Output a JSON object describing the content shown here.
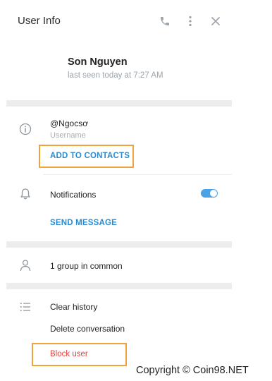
{
  "header": {
    "title": "User Info"
  },
  "profile": {
    "name": "Son Nguyen",
    "last_seen": "last seen today at 7:27 AM"
  },
  "info": {
    "username_value": "@Ngocsơ",
    "username_label": "Username",
    "add_contacts": "ADD TO CONTACTS"
  },
  "notifications": {
    "label": "Notifications",
    "enabled": true,
    "send_message": "SEND MESSAGE"
  },
  "groups": {
    "common": "1 group in common"
  },
  "actions": {
    "clear_history": "Clear history",
    "delete_conversation": "Delete conversation",
    "block_user": "Block user"
  },
  "watermark": {
    "text": "Copyright © Coin98.NET"
  },
  "colors": {
    "link": "#2a8bd0",
    "danger": "#e0403c",
    "highlight": "#f0a33c",
    "toggle_on": "#4aa3e6"
  },
  "icons": [
    "phone-icon",
    "more-vertical-icon",
    "close-icon",
    "info-icon",
    "bell-icon",
    "user-icon",
    "list-icon"
  ]
}
